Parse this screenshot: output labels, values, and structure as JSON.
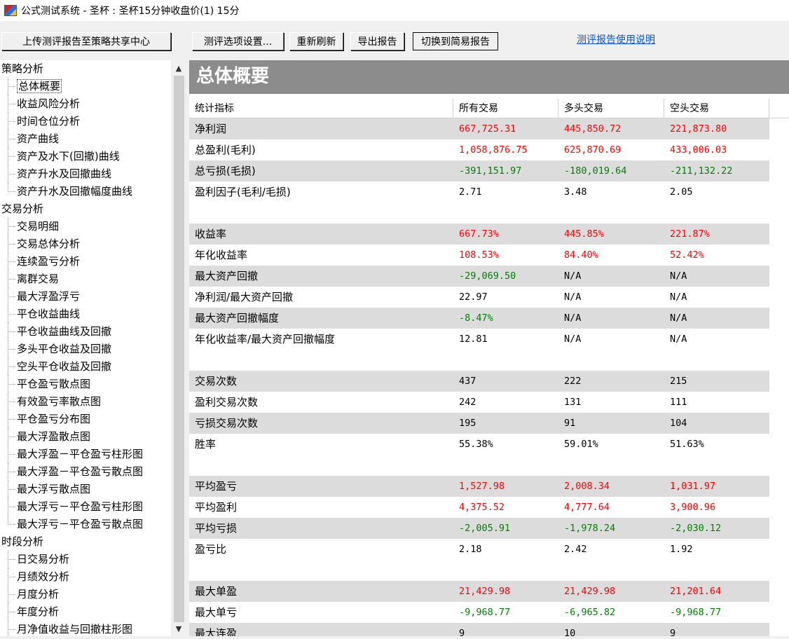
{
  "window": {
    "title": "公式测试系统 - 圣杯 : 圣杯15分钟收盘价(1) 15分"
  },
  "toolbar": {
    "upload": "上传测评报告至策略共享中心",
    "settings": "测评选项设置...",
    "refresh": "重新刷新",
    "export": "导出报告",
    "switch": "切换到简易报告",
    "help": "测评报告使用说明"
  },
  "tree": [
    {
      "label": "策略分析",
      "type": "cat"
    },
    {
      "label": "总体概要",
      "type": "item",
      "selected": true
    },
    {
      "label": "收益风险分析",
      "type": "item"
    },
    {
      "label": "时间仓位分析",
      "type": "item"
    },
    {
      "label": "资产曲线",
      "type": "item"
    },
    {
      "label": "资产及水下(回撤)曲线",
      "type": "item"
    },
    {
      "label": "资产升水及回撤曲线",
      "type": "item"
    },
    {
      "label": "资产升水及回撤幅度曲线",
      "type": "item",
      "last": true
    },
    {
      "label": "交易分析",
      "type": "cat"
    },
    {
      "label": "交易明细",
      "type": "item"
    },
    {
      "label": "交易总体分析",
      "type": "item"
    },
    {
      "label": "连续盈亏分析",
      "type": "item"
    },
    {
      "label": "离群交易",
      "type": "item"
    },
    {
      "label": "最大浮盈浮亏",
      "type": "item"
    },
    {
      "label": "平仓收益曲线",
      "type": "item"
    },
    {
      "label": "平仓收益曲线及回撤",
      "type": "item"
    },
    {
      "label": "多头平仓收益及回撤",
      "type": "item"
    },
    {
      "label": "空头平仓收益及回撤",
      "type": "item"
    },
    {
      "label": "平仓盈亏散点图",
      "type": "item"
    },
    {
      "label": "有效盈亏率散点图",
      "type": "item"
    },
    {
      "label": "平仓盈亏分布图",
      "type": "item"
    },
    {
      "label": "最大浮盈散点图",
      "type": "item"
    },
    {
      "label": "最大浮盈－平仓盈亏柱形图",
      "type": "item"
    },
    {
      "label": "最大浮盈－平仓盈亏散点图",
      "type": "item"
    },
    {
      "label": "最大浮亏散点图",
      "type": "item"
    },
    {
      "label": "最大浮亏－平仓盈亏柱形图",
      "type": "item"
    },
    {
      "label": "最大浮亏－平仓盈亏散点图",
      "type": "item",
      "last": true
    },
    {
      "label": "时段分析",
      "type": "cat"
    },
    {
      "label": "日交易分析",
      "type": "item"
    },
    {
      "label": "月绩效分析",
      "type": "item"
    },
    {
      "label": "月度分析",
      "type": "item"
    },
    {
      "label": "年度分析",
      "type": "item"
    },
    {
      "label": "月净值收益与回撤柱形图",
      "type": "item"
    }
  ],
  "report": {
    "title": "总体概要",
    "columns": [
      "统计指标",
      "所有交易",
      "多头交易",
      "空头交易"
    ],
    "rows": [
      {
        "label": "净利润",
        "values": [
          "667,725.31",
          "445,850.72",
          "221,873.80"
        ],
        "color": "red",
        "alt": true
      },
      {
        "label": "总盈利(毛利)",
        "values": [
          "1,058,876.75",
          "625,870.69",
          "433,006.03"
        ],
        "color": "red"
      },
      {
        "label": "总亏损(毛损)",
        "values": [
          "-391,151.97",
          "-180,019.64",
          "-211,132.22"
        ],
        "color": "green",
        "alt": true
      },
      {
        "label": "盈利因子(毛利/毛损)",
        "values": [
          "2.71",
          "3.48",
          "2.05"
        ],
        "color": "blk"
      },
      {
        "label": "",
        "values": [
          "",
          "",
          ""
        ],
        "color": "blk"
      },
      {
        "label": "收益率",
        "values": [
          "667.73%",
          "445.85%",
          "221.87%"
        ],
        "color": "red",
        "alt": true
      },
      {
        "label": "年化收益率",
        "values": [
          "108.53%",
          "84.40%",
          "52.42%"
        ],
        "color": "red"
      },
      {
        "label": "最大资产回撤",
        "values": [
          "-29,069.50",
          "N/A",
          "N/A"
        ],
        "color": "green",
        "alt": true,
        "restBlack": true
      },
      {
        "label": "净利润/最大资产回撤",
        "values": [
          "22.97",
          "N/A",
          "N/A"
        ],
        "color": "blk"
      },
      {
        "label": "最大资产回撤幅度",
        "values": [
          "-8.47%",
          "N/A",
          "N/A"
        ],
        "color": "green",
        "alt": true,
        "restBlack": true
      },
      {
        "label": "年化收益率/最大资产回撤幅度",
        "values": [
          "12.81",
          "N/A",
          "N/A"
        ],
        "color": "blk"
      },
      {
        "label": "",
        "values": [
          "",
          "",
          ""
        ],
        "color": "blk"
      },
      {
        "label": "交易次数",
        "values": [
          "437",
          "222",
          "215"
        ],
        "color": "blk",
        "alt": true
      },
      {
        "label": "盈利交易次数",
        "values": [
          "242",
          "131",
          "111"
        ],
        "color": "blk"
      },
      {
        "label": "亏损交易次数",
        "values": [
          "195",
          "91",
          "104"
        ],
        "color": "blk",
        "alt": true
      },
      {
        "label": "胜率",
        "values": [
          "55.38%",
          "59.01%",
          "51.63%"
        ],
        "color": "blk"
      },
      {
        "label": "",
        "values": [
          "",
          "",
          ""
        ],
        "color": "blk"
      },
      {
        "label": "平均盈亏",
        "values": [
          "1,527.98",
          "2,008.34",
          "1,031.97"
        ],
        "color": "red",
        "alt": true
      },
      {
        "label": "平均盈利",
        "values": [
          "4,375.52",
          "4,777.64",
          "3,900.96"
        ],
        "color": "red"
      },
      {
        "label": "平均亏损",
        "values": [
          "-2,005.91",
          "-1,978.24",
          "-2,030.12"
        ],
        "color": "green",
        "alt": true
      },
      {
        "label": "盈亏比",
        "values": [
          "2.18",
          "2.42",
          "1.92"
        ],
        "color": "blk"
      },
      {
        "label": "",
        "values": [
          "",
          "",
          ""
        ],
        "color": "blk"
      },
      {
        "label": "最大单盈",
        "values": [
          "21,429.98",
          "21,429.98",
          "21,201.64"
        ],
        "color": "red",
        "alt": true
      },
      {
        "label": "最大单亏",
        "values": [
          "-9,968.77",
          "-6,965.82",
          "-9,968.77"
        ],
        "color": "green"
      },
      {
        "label": "最大连盈",
        "values": [
          "9",
          "10",
          "9"
        ],
        "color": "blk",
        "alt": true
      }
    ]
  }
}
